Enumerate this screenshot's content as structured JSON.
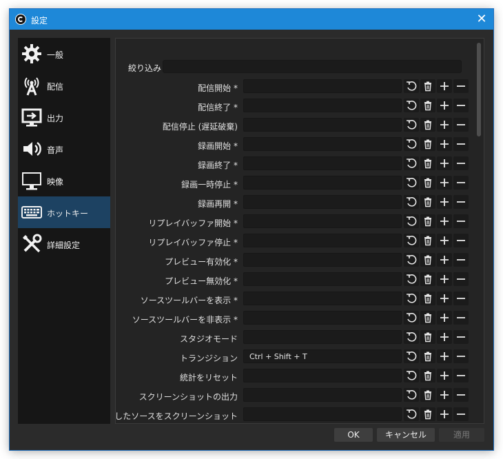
{
  "window": {
    "title": "設定",
    "close_glyph": "✕"
  },
  "sidebar": {
    "items": [
      {
        "label": "一般",
        "icon": "gear-icon",
        "active": false
      },
      {
        "label": "配信",
        "icon": "broadcast-icon",
        "active": false
      },
      {
        "label": "出力",
        "icon": "output-icon",
        "active": false
      },
      {
        "label": "音声",
        "icon": "speaker-icon",
        "active": false
      },
      {
        "label": "映像",
        "icon": "monitor-icon",
        "active": false
      },
      {
        "label": "ホットキー",
        "icon": "keyboard-icon",
        "active": true
      },
      {
        "label": "詳細設定",
        "icon": "tools-icon",
        "active": false
      }
    ]
  },
  "filter": {
    "label": "絞り込み",
    "value": ""
  },
  "hotkeys": [
    {
      "name": "配信開始 *",
      "value": ""
    },
    {
      "name": "配信終了 *",
      "value": ""
    },
    {
      "name": "配信停止 (遅延破棄)",
      "value": ""
    },
    {
      "name": "録画開始 *",
      "value": ""
    },
    {
      "name": "録画終了 *",
      "value": ""
    },
    {
      "name": "録画一時停止 *",
      "value": ""
    },
    {
      "name": "録画再開 *",
      "value": ""
    },
    {
      "name": "リプレイバッファ開始 *",
      "value": ""
    },
    {
      "name": "リプレイバッファ停止 *",
      "value": ""
    },
    {
      "name": "プレビュー有効化 *",
      "value": ""
    },
    {
      "name": "プレビュー無効化 *",
      "value": ""
    },
    {
      "name": "ソースツールバーを表示 *",
      "value": ""
    },
    {
      "name": "ソースツールバーを非表示 *",
      "value": ""
    },
    {
      "name": "スタジオモード",
      "value": ""
    },
    {
      "name": "トランジション",
      "value": "Ctrl + Shift + T"
    },
    {
      "name": "統計をリセット",
      "value": ""
    },
    {
      "name": "スクリーンショットの出力",
      "value": ""
    },
    {
      "name": "選択したソースをスクリーンショット",
      "value": ""
    }
  ],
  "buttons": {
    "ok": "OK",
    "cancel": "キャンセル",
    "apply": "適用"
  },
  "colors": {
    "titlebar": "#1e88d8",
    "active_item": "#1d4262",
    "background": "#2b2b2b"
  }
}
